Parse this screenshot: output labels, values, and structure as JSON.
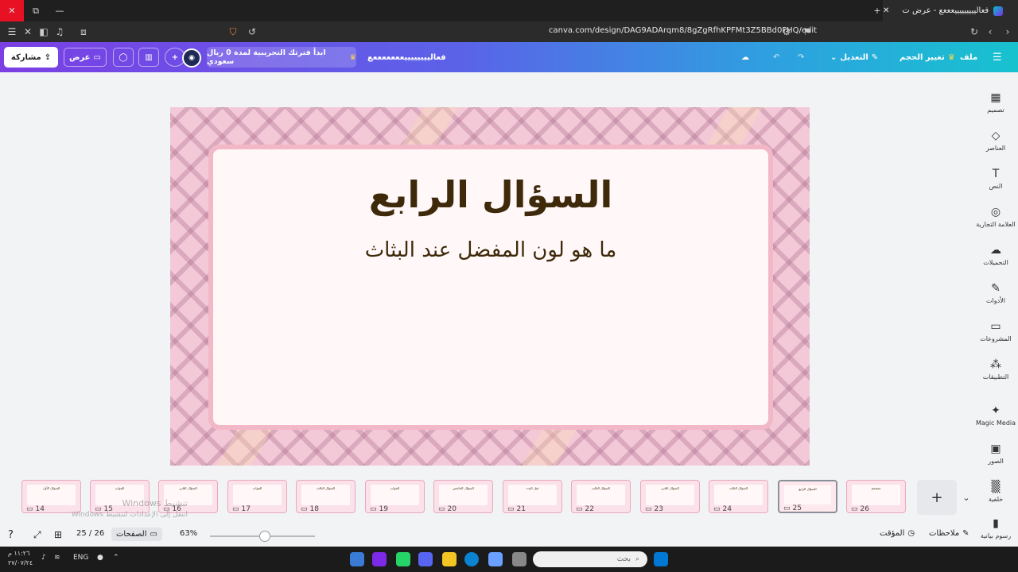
{
  "browser": {
    "tab_title": "فعاليييييييييعععع - عرض ت",
    "url": "canva.com/design/DAG9ADArqm8/8gZgRfhKPFMt3Z5BBd0FHQ/edit",
    "extension_badge": "3"
  },
  "header": {
    "menu_icon": "menu-icon",
    "file_label": "ملف",
    "resize_label": "تغيير الحجم",
    "edit_label": "التعديل",
    "doc_title": "فعالييييييييعععععععع",
    "trial_label": "ابدأ فترتك التجريبية لمدة 0 ريال سعودي",
    "present_label": "عرض",
    "share_label": "مشاركة"
  },
  "sidebar": {
    "items": [
      {
        "label": "تصميم",
        "icon": "▦"
      },
      {
        "label": "العناصر",
        "icon": "◇"
      },
      {
        "label": "النص",
        "icon": "T"
      },
      {
        "label": "العلامة التجارية",
        "icon": "◎"
      },
      {
        "label": "التحميلات",
        "icon": "☁"
      },
      {
        "label": "الأدوات",
        "icon": "✎"
      },
      {
        "label": "المشروعات",
        "icon": "▭"
      },
      {
        "label": "التطبيقات",
        "icon": "⁂"
      },
      {
        "label": "Magic Media",
        "icon": "✦"
      },
      {
        "label": "الصور",
        "icon": "▣"
      },
      {
        "label": "خلفية",
        "icon": "▒"
      },
      {
        "label": "رسوم بيانية",
        "icon": "▮"
      }
    ]
  },
  "slide": {
    "title": "السؤال الرابع",
    "subtitle": "ما هو لون المفضل عند البثاث"
  },
  "thumbnails": [
    {
      "num": "14",
      "title": "السؤال الأول"
    },
    {
      "num": "15",
      "title": "الجواب"
    },
    {
      "num": "16",
      "title": "السؤال الثاني"
    },
    {
      "num": "17",
      "title": "الجواب"
    },
    {
      "num": "18",
      "title": "السؤال الثالث"
    },
    {
      "num": "19",
      "title": "الجواب"
    },
    {
      "num": "20",
      "title": "السؤال الخامس"
    },
    {
      "num": "21",
      "title": "قبل البدء"
    },
    {
      "num": "22",
      "title": "السؤال الثالث"
    },
    {
      "num": "23",
      "title": "السؤال الثاني"
    },
    {
      "num": "24",
      "title": "السؤال الثالث"
    },
    {
      "num": "25",
      "title": "السؤال الرابع",
      "selected": true
    },
    {
      "num": "26",
      "title": "ممممم"
    }
  ],
  "bottombar": {
    "notes_label": "ملاحظات",
    "timer_label": "المؤقت",
    "zoom": "63%",
    "zoom_fraction": 0.52,
    "pages_label": "الصفحات",
    "page_counter": "25 / 26"
  },
  "watermark": {
    "line1": "تنشيط Windows",
    "line2": "انتقل إلى الإعدادات لتنشيط Windows"
  },
  "taskbar": {
    "search_placeholder": "بحث",
    "lang": "ENG",
    "time": "١١:٢٦ م",
    "date": "٢٧/٠٧/٢٤"
  }
}
